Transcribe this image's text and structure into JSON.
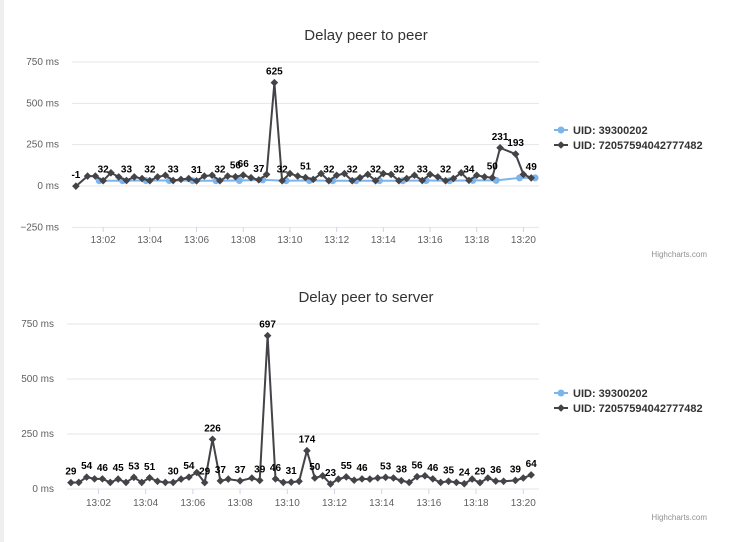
{
  "credits": "Highcharts.com",
  "colors": {
    "series1": "#7cb5ec",
    "series2": "#434348",
    "grid": "#e6e6e6"
  },
  "chart_data": [
    {
      "type": "line",
      "title": "Delay peer to peer",
      "y_unit": "ms",
      "yticks": [
        -250,
        0,
        250,
        500,
        750
      ],
      "ytick_labels": [
        "−250 ms",
        "0 ms",
        "250 ms",
        "500 ms",
        "750 ms"
      ],
      "ylim": [
        -250,
        750
      ],
      "xlim": [
        "13:00:40",
        "13:20:40"
      ],
      "xticks": [
        "13:02",
        "13:04",
        "13:06",
        "13:08",
        "13:10",
        "13:12",
        "13:14",
        "13:16",
        "13:18",
        "13:20"
      ],
      "legend_position": "right",
      "series": [
        {
          "name": "UID: 39300202",
          "color": "#7cb5ec",
          "marker": "circle",
          "data": [
            [
              "13:01:50",
              32
            ],
            [
              "13:02:50",
              32
            ],
            [
              "13:03:50",
              33
            ],
            [
              "13:04:50",
              33
            ],
            [
              "13:05:50",
              32
            ],
            [
              "13:06:50",
              32
            ],
            [
              "13:07:50",
              33
            ],
            [
              "13:08:50",
              37
            ],
            [
              "13:09:50",
              32
            ],
            [
              "13:10:50",
              33
            ],
            [
              "13:11:50",
              32
            ],
            [
              "13:12:50",
              32
            ],
            [
              "13:13:50",
              32
            ],
            [
              "13:14:50",
              32
            ],
            [
              "13:15:50",
              33
            ],
            [
              "13:16:50",
              32
            ],
            [
              "13:17:50",
              34
            ],
            [
              "13:18:50",
              34
            ],
            [
              "13:19:50",
              49
            ],
            [
              "13:20:30",
              49
            ]
          ],
          "labels": []
        },
        {
          "name": "UID: 72057594042777482",
          "color": "#434348",
          "marker": "diamond",
          "data": [
            [
              "13:00:50",
              -1
            ],
            [
              "13:01:20",
              60
            ],
            [
              "13:01:40",
              60
            ],
            [
              "13:02:00",
              32
            ],
            [
              "13:02:20",
              80
            ],
            [
              "13:02:40",
              55
            ],
            [
              "13:03:00",
              33
            ],
            [
              "13:03:20",
              55
            ],
            [
              "13:03:40",
              45
            ],
            [
              "13:04:00",
              32
            ],
            [
              "13:04:20",
              55
            ],
            [
              "13:04:40",
              65
            ],
            [
              "13:05:00",
              33
            ],
            [
              "13:05:20",
              40
            ],
            [
              "13:05:40",
              45
            ],
            [
              "13:06:00",
              31
            ],
            [
              "13:06:20",
              60
            ],
            [
              "13:06:40",
              65
            ],
            [
              "13:07:00",
              32
            ],
            [
              "13:07:20",
              60
            ],
            [
              "13:07:40",
              56
            ],
            [
              "13:08:00",
              66
            ],
            [
              "13:08:20",
              50
            ],
            [
              "13:08:40",
              37
            ],
            [
              "13:09:00",
              70
            ],
            [
              "13:09:20",
              625
            ],
            [
              "13:09:40",
              32
            ],
            [
              "13:10:00",
              75
            ],
            [
              "13:10:20",
              60
            ],
            [
              "13:10:40",
              51
            ],
            [
              "13:11:00",
              40
            ],
            [
              "13:11:20",
              75
            ],
            [
              "13:11:40",
              32
            ],
            [
              "13:12:00",
              65
            ],
            [
              "13:12:20",
              75
            ],
            [
              "13:12:40",
              32
            ],
            [
              "13:13:00",
              50
            ],
            [
              "13:13:20",
              70
            ],
            [
              "13:13:40",
              32
            ],
            [
              "13:14:00",
              75
            ],
            [
              "13:14:20",
              70
            ],
            [
              "13:14:40",
              32
            ],
            [
              "13:15:00",
              45
            ],
            [
              "13:15:20",
              65
            ],
            [
              "13:15:40",
              33
            ],
            [
              "13:16:00",
              70
            ],
            [
              "13:16:20",
              55
            ],
            [
              "13:16:40",
              32
            ],
            [
              "13:17:00",
              45
            ],
            [
              "13:17:20",
              80
            ],
            [
              "13:17:40",
              34
            ],
            [
              "13:18:00",
              65
            ],
            [
              "13:18:20",
              55
            ],
            [
              "13:18:40",
              50
            ],
            [
              "13:19:00",
              231
            ],
            [
              "13:19:40",
              193
            ],
            [
              "13:20:00",
              70
            ],
            [
              "13:20:20",
              49
            ]
          ],
          "labels": [
            [
              -1,
              "-1"
            ],
            [
              0,
              "-1"
            ]
          ]
        }
      ],
      "data_labels": [
        [
          "13:00:50",
          -1
        ],
        [
          "13:02:00",
          32
        ],
        [
          "13:03:00",
          33
        ],
        [
          "13:04:00",
          32
        ],
        [
          "13:05:00",
          33
        ],
        [
          "13:06:00",
          31
        ],
        [
          "13:07:00",
          32
        ],
        [
          "13:07:40",
          56
        ],
        [
          "13:08:00",
          66
        ],
        [
          "13:08:40",
          37
        ],
        [
          "13:09:20",
          625
        ],
        [
          "13:09:40",
          32
        ],
        [
          "13:10:40",
          51
        ],
        [
          "13:11:40",
          32
        ],
        [
          "13:12:40",
          32
        ],
        [
          "13:13:40",
          32
        ],
        [
          "13:14:40",
          32
        ],
        [
          "13:15:40",
          33
        ],
        [
          "13:16:40",
          32
        ],
        [
          "13:17:40",
          34
        ],
        [
          "13:18:40",
          50
        ],
        [
          "13:19:00",
          231
        ],
        [
          "13:19:40",
          193
        ],
        [
          "13:20:20",
          49
        ]
      ]
    },
    {
      "type": "line",
      "title": "Delay peer to server",
      "y_unit": "ms",
      "yticks": [
        0,
        250,
        500,
        750
      ],
      "ytick_labels": [
        "0 ms",
        "250 ms",
        "500 ms",
        "750 ms"
      ],
      "ylim": [
        0,
        750
      ],
      "xlim": [
        "13:00:40",
        "13:20:40"
      ],
      "xticks": [
        "13:02",
        "13:04",
        "13:06",
        "13:08",
        "13:10",
        "13:12",
        "13:14",
        "13:16",
        "13:18",
        "13:20"
      ],
      "legend_position": "right",
      "series": [
        {
          "name": "UID: 39300202",
          "color": "#7cb5ec",
          "marker": "circle",
          "data": [],
          "labels": []
        },
        {
          "name": "UID: 72057594042777482",
          "color": "#434348",
          "marker": "diamond",
          "data": [
            [
              "13:00:50",
              29
            ],
            [
              "13:01:10",
              30
            ],
            [
              "13:01:30",
              54
            ],
            [
              "13:01:50",
              46
            ],
            [
              "13:02:10",
              46
            ],
            [
              "13:02:30",
              30
            ],
            [
              "13:02:50",
              45
            ],
            [
              "13:03:10",
              30
            ],
            [
              "13:03:30",
              53
            ],
            [
              "13:03:50",
              30
            ],
            [
              "13:04:10",
              51
            ],
            [
              "13:04:30",
              35
            ],
            [
              "13:04:50",
              30
            ],
            [
              "13:05:10",
              30
            ],
            [
              "13:05:30",
              45
            ],
            [
              "13:05:50",
              54
            ],
            [
              "13:06:10",
              75
            ],
            [
              "13:06:30",
              29
            ],
            [
              "13:06:50",
              226
            ],
            [
              "13:07:10",
              37
            ],
            [
              "13:07:30",
              45
            ],
            [
              "13:08:00",
              37
            ],
            [
              "13:08:30",
              50
            ],
            [
              "13:08:50",
              39
            ],
            [
              "13:09:10",
              697
            ],
            [
              "13:09:30",
              46
            ],
            [
              "13:09:50",
              30
            ],
            [
              "13:10:10",
              31
            ],
            [
              "13:10:30",
              35
            ],
            [
              "13:10:50",
              174
            ],
            [
              "13:11:10",
              50
            ],
            [
              "13:11:30",
              60
            ],
            [
              "13:11:50",
              23
            ],
            [
              "13:12:10",
              45
            ],
            [
              "13:12:30",
              55
            ],
            [
              "13:12:50",
              40
            ],
            [
              "13:13:10",
              46
            ],
            [
              "13:13:30",
              45
            ],
            [
              "13:13:50",
              50
            ],
            [
              "13:14:10",
              53
            ],
            [
              "13:14:30",
              50
            ],
            [
              "13:14:50",
              38
            ],
            [
              "13:15:10",
              30
            ],
            [
              "13:15:30",
              56
            ],
            [
              "13:15:50",
              60
            ],
            [
              "13:16:10",
              46
            ],
            [
              "13:16:30",
              30
            ],
            [
              "13:16:50",
              35
            ],
            [
              "13:17:10",
              30
            ],
            [
              "13:17:30",
              24
            ],
            [
              "13:17:50",
              45
            ],
            [
              "13:18:10",
              29
            ],
            [
              "13:18:30",
              50
            ],
            [
              "13:18:50",
              36
            ],
            [
              "13:19:10",
              35
            ],
            [
              "13:19:40",
              39
            ],
            [
              "13:20:00",
              50
            ],
            [
              "13:20:20",
              64
            ]
          ],
          "labels": []
        }
      ],
      "data_labels": [
        [
          "13:00:50",
          29
        ],
        [
          "13:01:30",
          54
        ],
        [
          "13:02:10",
          46
        ],
        [
          "13:02:50",
          45
        ],
        [
          "13:03:30",
          53
        ],
        [
          "13:04:10",
          51
        ],
        [
          "13:05:10",
          30
        ],
        [
          "13:05:50",
          54
        ],
        [
          "13:06:30",
          29
        ],
        [
          "13:06:50",
          226
        ],
        [
          "13:07:10",
          37
        ],
        [
          "13:08:00",
          37
        ],
        [
          "13:08:50",
          39
        ],
        [
          "13:09:10",
          697
        ],
        [
          "13:09:30",
          46
        ],
        [
          "13:10:10",
          31
        ],
        [
          "13:10:50",
          174
        ],
        [
          "13:11:10",
          50
        ],
        [
          "13:11:50",
          23
        ],
        [
          "13:12:30",
          55
        ],
        [
          "13:13:10",
          46
        ],
        [
          "13:14:10",
          53
        ],
        [
          "13:14:50",
          38
        ],
        [
          "13:15:30",
          56
        ],
        [
          "13:16:10",
          46
        ],
        [
          "13:16:50",
          35
        ],
        [
          "13:17:30",
          24
        ],
        [
          "13:18:10",
          29
        ],
        [
          "13:18:50",
          36
        ],
        [
          "13:19:40",
          39
        ],
        [
          "13:20:20",
          64
        ]
      ]
    }
  ]
}
